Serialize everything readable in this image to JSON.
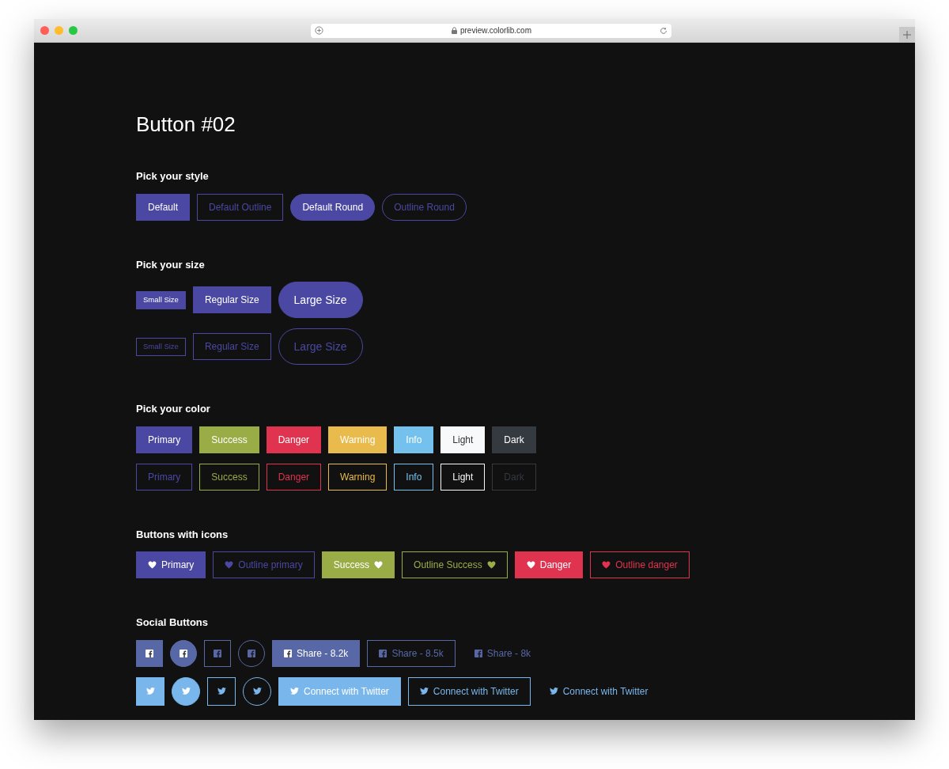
{
  "browser": {
    "url": "preview.colorlib.com"
  },
  "heading": "Button #02",
  "sections": [
    {
      "title": "Pick your style",
      "rows": [
        {
          "buttons": [
            {
              "label": "Default",
              "kind": "solid",
              "color": "#4b48a3"
            },
            {
              "label": "Default Outline",
              "kind": "outline",
              "color": "#4b48a3"
            },
            {
              "label": "Default Round",
              "kind": "solid-round",
              "color": "#4b48a3"
            },
            {
              "label": "Outline Round",
              "kind": "outline-round",
              "color": "#4b48a3"
            }
          ]
        }
      ]
    },
    {
      "title": "Pick your size",
      "rows": [
        {
          "buttons": [
            {
              "label": "Small Size",
              "kind": "solid-small",
              "color": "#4b48a3"
            },
            {
              "label": "Regular Size",
              "kind": "solid",
              "color": "#4b48a3"
            },
            {
              "label": "Large Size",
              "kind": "solid-large",
              "color": "#4b48a3"
            }
          ]
        },
        {
          "buttons": [
            {
              "label": "Small Size",
              "kind": "outline-small",
              "color": "#4b48a3"
            },
            {
              "label": "Regular Size",
              "kind": "outline",
              "color": "#4b48a3"
            },
            {
              "label": "Large Size",
              "kind": "outline-large",
              "color": "#4b48a3"
            }
          ]
        }
      ]
    },
    {
      "title": "Pick your color",
      "rows": [
        {
          "buttons": [
            {
              "label": "Primary",
              "kind": "solid",
              "color": "#4b48a3"
            },
            {
              "label": "Success",
              "kind": "solid",
              "color": "#9aac45"
            },
            {
              "label": "Danger",
              "kind": "solid",
              "color": "#e0334f"
            },
            {
              "label": "Warning",
              "kind": "solid",
              "color": "#e9bb4c"
            },
            {
              "label": "Info",
              "kind": "solid",
              "color": "#73c1ec"
            },
            {
              "label": "Light",
              "kind": "solid",
              "color": "#f8f9fa"
            },
            {
              "label": "Dark",
              "kind": "solid",
              "color": "#343a40"
            }
          ]
        },
        {
          "buttons": [
            {
              "label": "Primary",
              "kind": "outline",
              "color": "#4b48a3"
            },
            {
              "label": "Success",
              "kind": "outline",
              "color": "#9aac45"
            },
            {
              "label": "Danger",
              "kind": "outline",
              "color": "#e0334f"
            },
            {
              "label": "Warning",
              "kind": "outline",
              "color": "#e9bb4c"
            },
            {
              "label": "Info",
              "kind": "outline",
              "color": "#73c1ec"
            },
            {
              "label": "Light",
              "kind": "outline",
              "color": "#f8f9fa"
            },
            {
              "label": "Dark",
              "kind": "outline",
              "color": "#343a40"
            }
          ]
        }
      ]
    },
    {
      "title": "Buttons with icons",
      "rows": [
        {
          "buttons": [
            {
              "label": "Primary",
              "kind": "solid",
              "color": "#4b48a3"
            },
            {
              "label": "Outline primary",
              "kind": "outline",
              "color": "#4b48a3"
            },
            {
              "label": "Success",
              "kind": "solid-trailing",
              "color": "#9aac45"
            },
            {
              "label": "Outline Success",
              "kind": "outline-trailing",
              "color": "#9aac45"
            },
            {
              "label": "Danger",
              "kind": "solid",
              "color": "#e0334f"
            },
            {
              "label": "Outline danger",
              "kind": "outline",
              "color": "#e0334f"
            }
          ]
        }
      ]
    },
    {
      "title": "Social Buttons",
      "rows": [
        {
          "buttons": [
            {
              "kind": "solid",
              "color": "#5868a6"
            },
            {
              "kind": "solid-circle",
              "color": "#5868a6"
            },
            {
              "kind": "outline",
              "color": "#5868a6"
            },
            {
              "kind": "outline-circle",
              "color": "#5868a6"
            },
            {
              "label": "Share - 8.2k",
              "kind": "solid",
              "color": "#5868a6"
            },
            {
              "label": "Share - 8.5k",
              "kind": "outline",
              "color": "#5868a6"
            },
            {
              "label": "Share - 8k",
              "kind": "link",
              "color": "#5868a6"
            }
          ]
        },
        {
          "buttons": [
            {
              "kind": "solid",
              "color": "#79b6ec"
            },
            {
              "kind": "solid-circle",
              "color": "#79b6ec"
            },
            {
              "kind": "outline",
              "color": "#79b6ec"
            },
            {
              "kind": "outline-circle",
              "color": "#79b6ec"
            },
            {
              "label": "Connect with Twitter",
              "kind": "solid",
              "color": "#79b6ec"
            },
            {
              "label": "Connect with Twitter",
              "kind": "outline",
              "color": "#79b6ec"
            },
            {
              "label": "Connect with Twitter",
              "kind": "link",
              "color": "#79b6ec"
            }
          ]
        }
      ]
    }
  ]
}
